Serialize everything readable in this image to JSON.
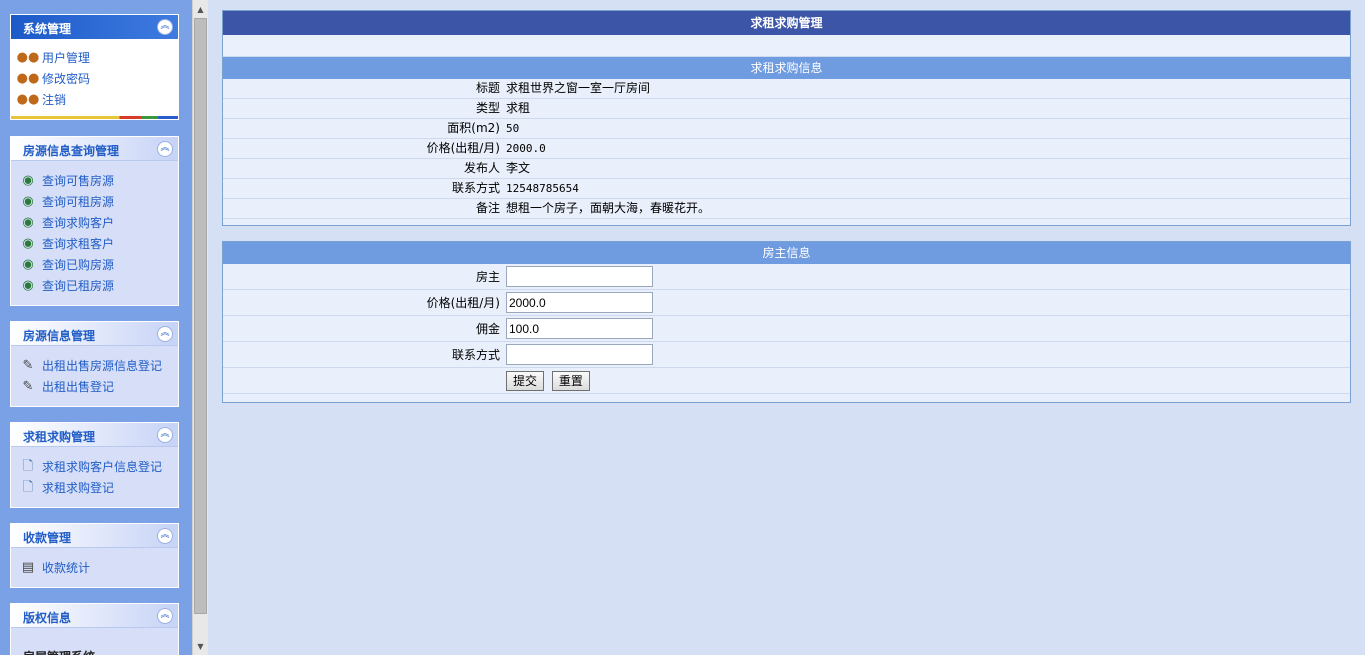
{
  "sidebar": {
    "system": {
      "title": "系统管理",
      "items": [
        {
          "label": "用户管理",
          "icon": "users-icon"
        },
        {
          "label": "修改密码",
          "icon": "users-icon"
        },
        {
          "label": "注销",
          "icon": "users-icon"
        }
      ]
    },
    "query": {
      "title": "房源信息查询管理",
      "items": [
        {
          "label": "查询可售房源",
          "icon": "globe-icon"
        },
        {
          "label": "查询可租房源",
          "icon": "globe-icon"
        },
        {
          "label": "查询求购客户",
          "icon": "globe-icon"
        },
        {
          "label": "查询求租客户",
          "icon": "globe-icon"
        },
        {
          "label": "查询已购房源",
          "icon": "globe-icon"
        },
        {
          "label": "查询已租房源",
          "icon": "globe-icon"
        }
      ]
    },
    "house": {
      "title": "房源信息管理",
      "items": [
        {
          "label": "出租出售房源信息登记",
          "icon": "edit-icon"
        },
        {
          "label": "出租出售登记",
          "icon": "edit-icon"
        }
      ]
    },
    "rent": {
      "title": "求租求购管理",
      "items": [
        {
          "label": "求租求购客户信息登记",
          "icon": "document-icon"
        },
        {
          "label": "求租求购登记",
          "icon": "document-icon"
        }
      ]
    },
    "money": {
      "title": "收款管理",
      "items": [
        {
          "label": "收款统计",
          "icon": "statistics-icon"
        }
      ]
    },
    "copyright": {
      "title": "版权信息",
      "text": "房屋管理系统"
    }
  },
  "main": {
    "page_title": "求租求购管理",
    "info_section": {
      "title": "求租求购信息",
      "rows": [
        {
          "label": "标题",
          "value": "求租世界之窗一室一厅房间"
        },
        {
          "label": "类型",
          "value": "求租"
        },
        {
          "label": "面积(m2)",
          "value": "50"
        },
        {
          "label": "价格(出租/月)",
          "value": "2000.0"
        },
        {
          "label": "发布人",
          "value": "李文"
        },
        {
          "label": "联系方式",
          "value": "12548785654"
        },
        {
          "label": "备注",
          "value": "想租一个房子，面朝大海，春暖花开。"
        }
      ]
    },
    "owner_section": {
      "title": "房主信息",
      "fields": [
        {
          "label": "房主",
          "value": ""
        },
        {
          "label": "价格(出租/月)",
          "value": "2000.0"
        },
        {
          "label": "佣金",
          "value": "100.0"
        },
        {
          "label": "联系方式",
          "value": ""
        }
      ],
      "submit_label": "提交",
      "reset_label": "重置"
    }
  }
}
